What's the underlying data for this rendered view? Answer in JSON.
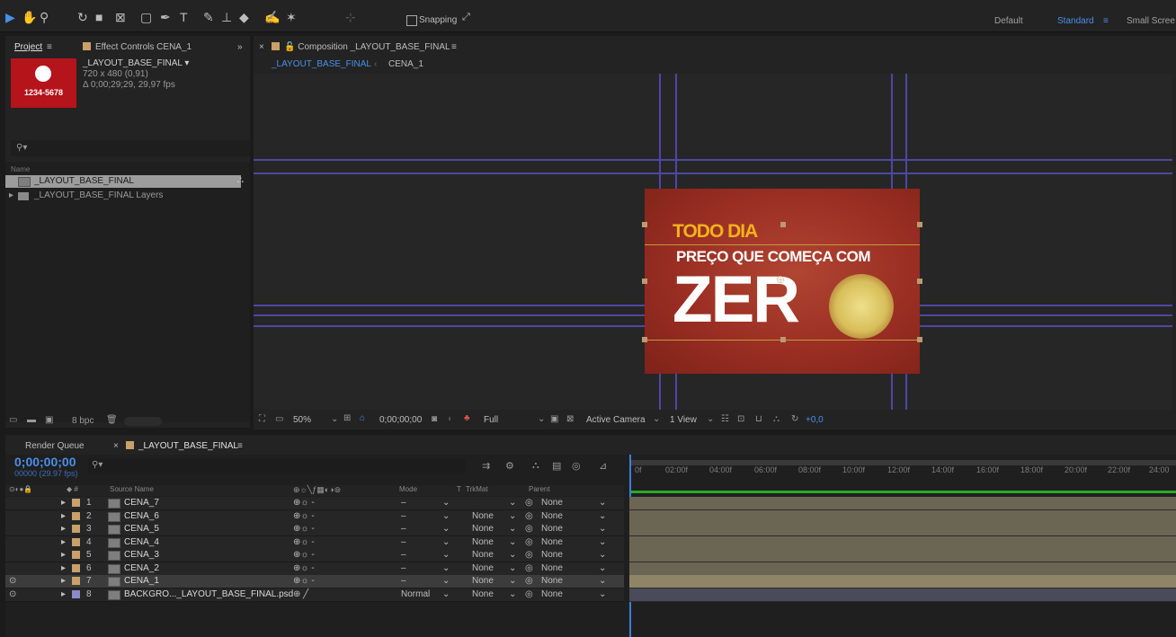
{
  "toolbar": {
    "snapping_label": "Snapping",
    "workspaces": [
      {
        "label": "Default",
        "active": false
      },
      {
        "label": "Standard",
        "active": true
      },
      {
        "label": "Small Scree",
        "active": false
      }
    ]
  },
  "project_panel": {
    "tab_project": "Project",
    "tab_effect_controls": "Effect Controls CENA_1",
    "item_name": "_LAYOUT_BASE_FINAL ▾",
    "item_size": "720 x 480 (0,91)",
    "item_duration": "Δ 0;00;29;29, 29,97 fps",
    "thumb_text": "1234-5678",
    "column_name": "Name",
    "items": [
      {
        "name": "_LAYOUT_BASE_FINAL",
        "selected": true
      },
      {
        "name": "_LAYOUT_BASE_FINAL Layers",
        "selected": false
      }
    ],
    "bpc": "8 bpc"
  },
  "composition": {
    "tab_title": "Composition _LAYOUT_BASE_FINAL",
    "breadcrumb_current": "_LAYOUT_BASE_FINAL",
    "breadcrumb_child": "CENA_1",
    "text_line1": "TODO DIA",
    "text_line2": "PREÇO QUE COMEÇA COM",
    "text_line3": "ZER",
    "footer": {
      "zoom": "50%",
      "timecode": "0;00;00;00",
      "resolution": "Full",
      "camera": "Active Camera",
      "views": "1 View",
      "exposure": "+0,0"
    }
  },
  "timeline": {
    "tab_render_queue": "Render Queue",
    "tab_comp": "_LAYOUT_BASE_FINAL",
    "current_time": "0;00;00;00",
    "current_frame": "00000 (29.97 fps)",
    "columns": {
      "source_name": "Source Name",
      "mode": "Mode",
      "t": "T",
      "trkmat": "TrkMat",
      "parent": "Parent"
    },
    "ruler": [
      "0f",
      "02:00f",
      "04:00f",
      "06:00f",
      "08:00f",
      "10:00f",
      "12:00f",
      "14:00f",
      "16:00f",
      "18:00f",
      "20:00f",
      "22:00f",
      "24:00"
    ],
    "layers": [
      {
        "num": "1",
        "name": "CENA_7",
        "mode": "–",
        "trkmat": "",
        "parent": "None",
        "selected": false
      },
      {
        "num": "2",
        "name": "CENA_6",
        "mode": "–",
        "trkmat": "None",
        "parent": "None",
        "selected": false
      },
      {
        "num": "3",
        "name": "CENA_5",
        "mode": "–",
        "trkmat": "None",
        "parent": "None",
        "selected": false
      },
      {
        "num": "4",
        "name": "CENA_4",
        "mode": "–",
        "trkmat": "None",
        "parent": "None",
        "selected": false
      },
      {
        "num": "5",
        "name": "CENA_3",
        "mode": "–",
        "trkmat": "None",
        "parent": "None",
        "selected": false
      },
      {
        "num": "6",
        "name": "CENA_2",
        "mode": "–",
        "trkmat": "None",
        "parent": "None",
        "selected": false
      },
      {
        "num": "7",
        "name": "CENA_1",
        "mode": "–",
        "trkmat": "None",
        "parent": "None",
        "selected": true
      },
      {
        "num": "8",
        "name": "BACKGRO..._LAYOUT_BASE_FINAL.psd",
        "mode": "Normal",
        "trkmat": "None",
        "parent": "None",
        "selected": false
      }
    ]
  },
  "colors": {
    "accent": "#4a8fe8",
    "label_swatch": "#c9a06a",
    "title_yellow": "#f3b21b",
    "guide": "#4f47a3",
    "artboard": "#9a2e23"
  }
}
